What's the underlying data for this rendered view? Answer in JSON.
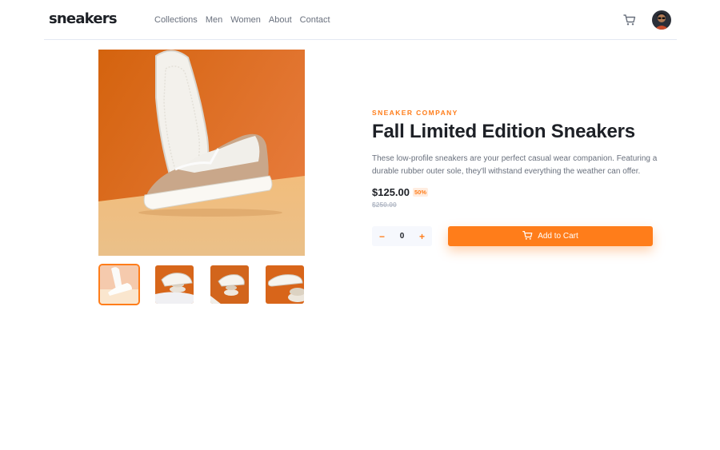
{
  "header": {
    "logo": "sneakers",
    "nav": [
      "Collections",
      "Men",
      "Women",
      "About",
      "Contact"
    ]
  },
  "product": {
    "company": "SNEAKER COMPANY",
    "title": "Fall Limited Edition Sneakers",
    "description": "These low-profile sneakers are your perfect casual wear companion. Featuring a durable rubber outer sole, they'll withstand everything the weather can offer.",
    "price": "$125.00",
    "discount": "50%",
    "old_price": "$250.00"
  },
  "cart": {
    "decrement": "−",
    "increment": "+",
    "quantity": "0",
    "add_label": "Add to Cart"
  },
  "colors": {
    "accent": "#ff7d1a",
    "accent_pale": "#ffede0",
    "text_dark": "#1d2026",
    "text_muted": "#69707d"
  },
  "icons": [
    "cart-icon",
    "avatar"
  ]
}
